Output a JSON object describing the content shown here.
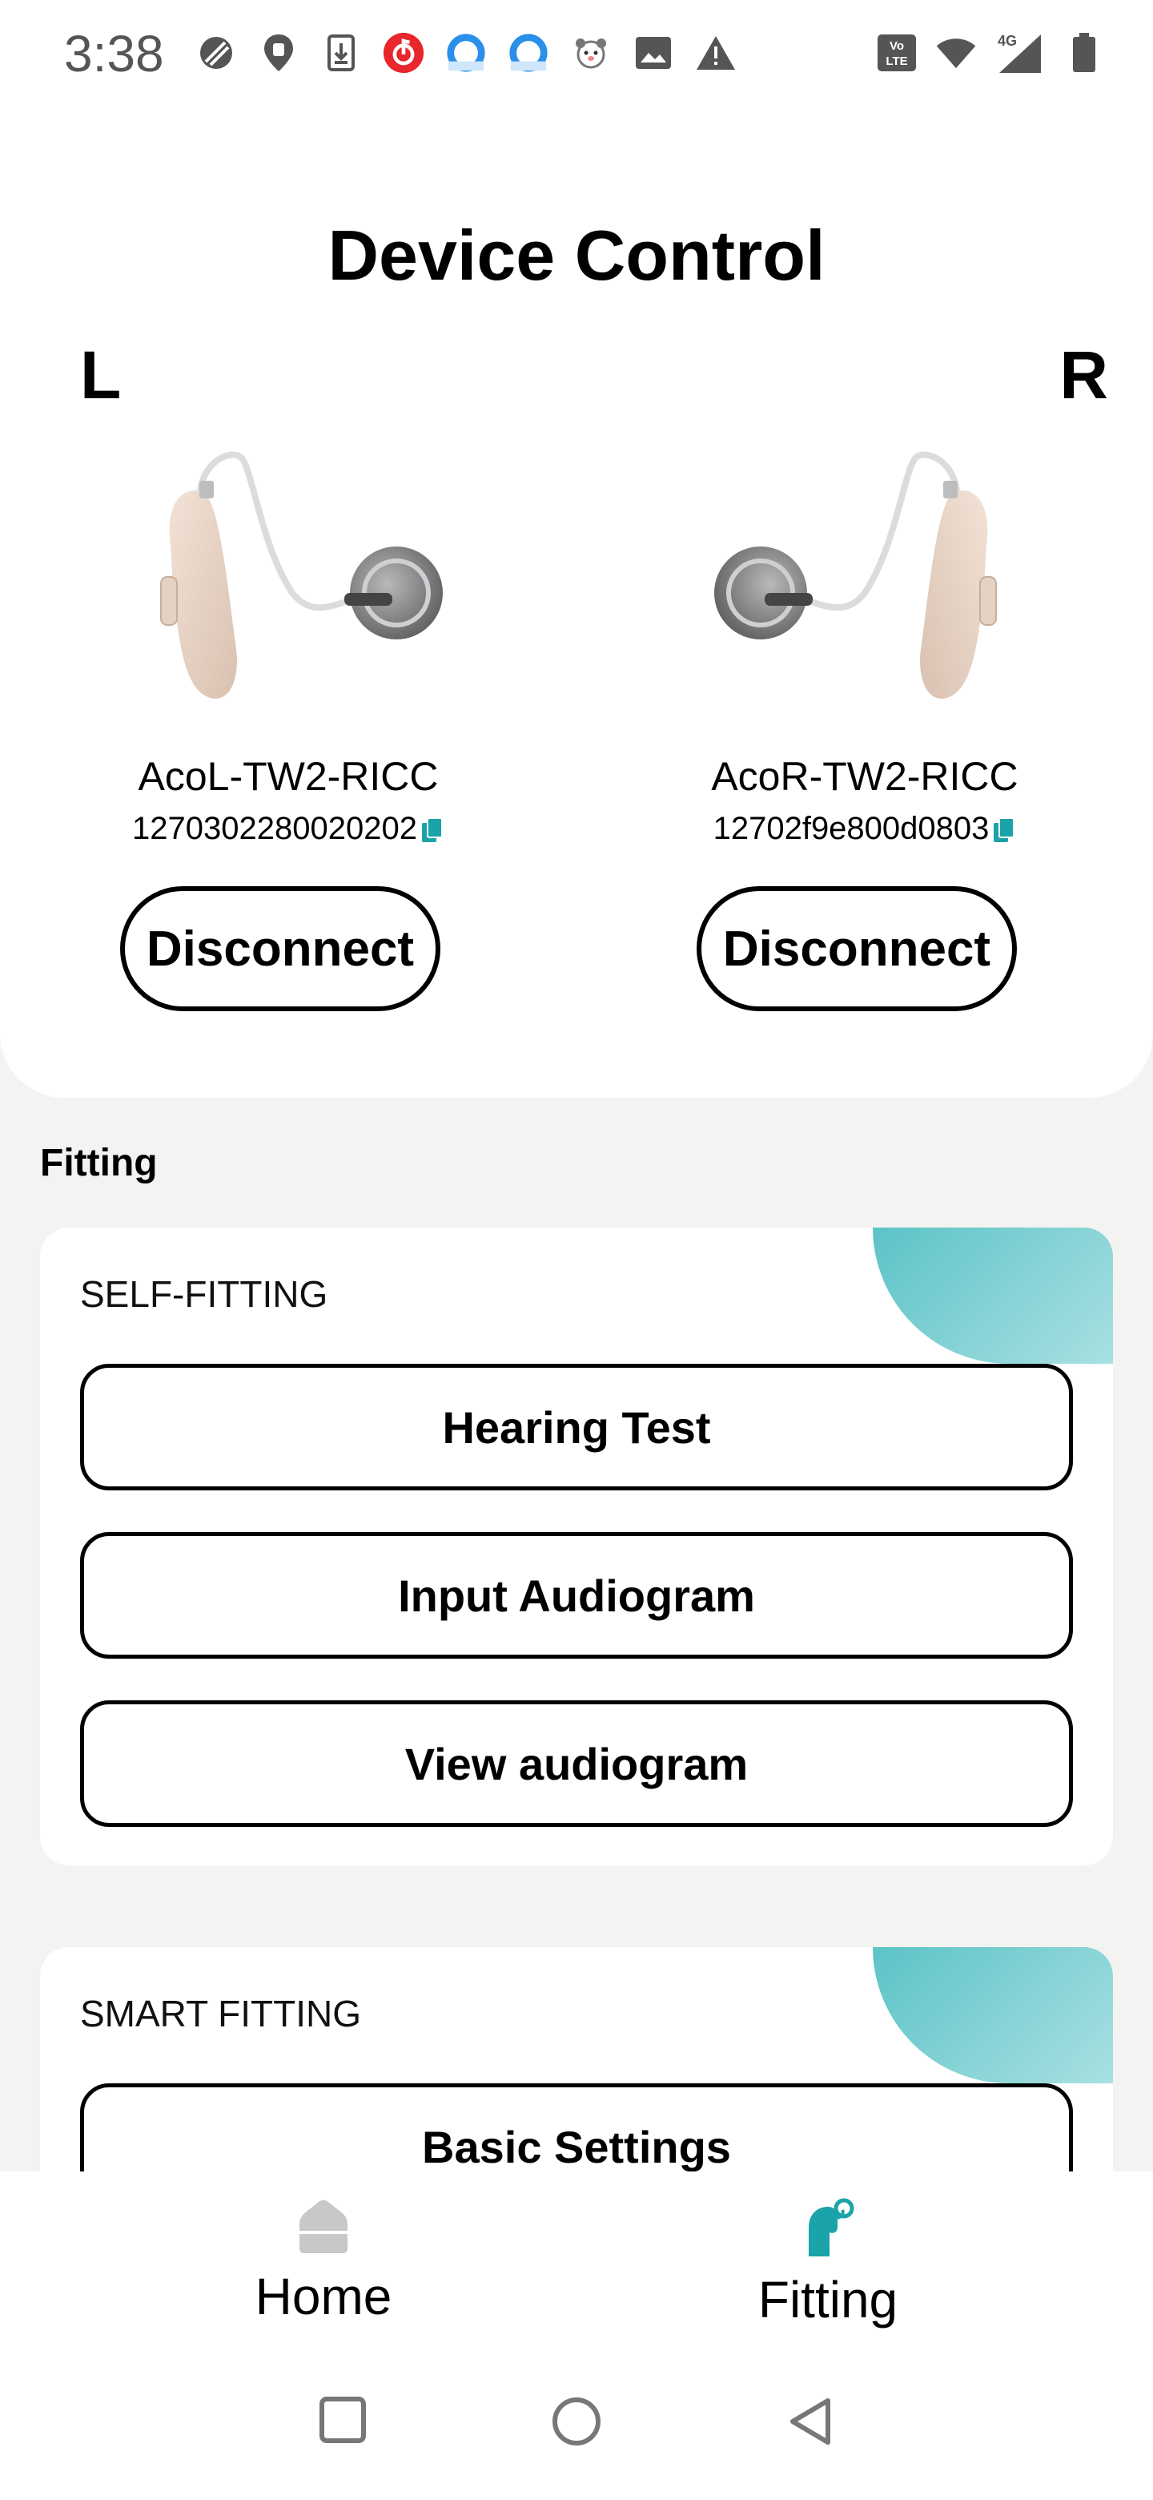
{
  "status_bar": {
    "time": "3:38",
    "icons_left": [
      "dnd-icon",
      "location-icon",
      "download-icon",
      "music-icon",
      "browser-icon",
      "browser-icon",
      "pet-icon",
      "image-icon",
      "warning-icon"
    ],
    "icons_right": [
      "volte-icon",
      "wifi-icon",
      "signal-4g-icon",
      "battery-icon"
    ],
    "network_label": "4G",
    "volte_label": "Vo LTE"
  },
  "header": {
    "title": "Device Control"
  },
  "devices": {
    "left": {
      "side": "L",
      "name": "AcoL-TW2-RICC",
      "serial": "1270302280020202",
      "button": "Disconnect"
    },
    "right": {
      "side": "R",
      "name": "AcoR-TW2-RICC",
      "serial": "12702f9e800d0803",
      "button": "Disconnect"
    }
  },
  "fitting": {
    "section_title": "Fitting",
    "self_fitting": {
      "title": "SELF-FITTING",
      "buttons": [
        "Hearing Test",
        "Input Audiogram",
        "View audiogram"
      ]
    },
    "smart_fitting": {
      "title": "SMART FITTING",
      "buttons": [
        "Basic Settings"
      ]
    }
  },
  "bottom_nav": {
    "items": [
      {
        "label": "Home",
        "icon": "home-icon",
        "active": false
      },
      {
        "label": "Fitting",
        "icon": "hearing-aid-icon",
        "active": true
      }
    ]
  },
  "colors": {
    "accent": "#1aa3a8",
    "inactive_icon": "#c8c8c8",
    "background": "#f3f3f1"
  }
}
